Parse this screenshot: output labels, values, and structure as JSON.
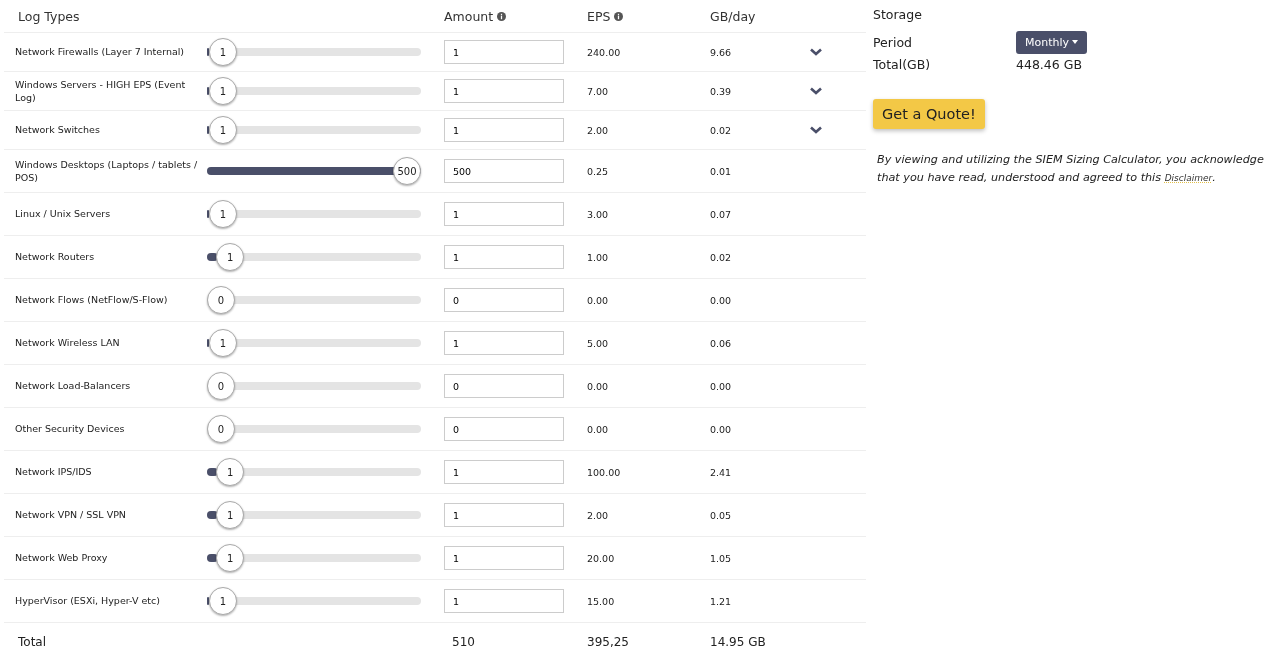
{
  "table": {
    "columns": [
      "Log Types",
      "Amount",
      "EPS",
      "GB/day"
    ],
    "rows": [
      {
        "name": "Network Firewalls (Layer 7 Internal)",
        "slider_value": "1",
        "level": 0.01,
        "amount": "1",
        "eps": "240.00",
        "gb_day": "9.66",
        "expandable": true
      },
      {
        "name": "Windows Servers - HIGH EPS (Event Log)",
        "slider_value": "1",
        "level": 0.01,
        "amount": "1",
        "eps": "7.00",
        "gb_day": "0.39",
        "expandable": true
      },
      {
        "name": "Network Switches",
        "slider_value": "1",
        "level": 0.01,
        "amount": "1",
        "eps": "2.00",
        "gb_day": "0.02",
        "expandable": true
      },
      {
        "name": "Windows Desktops (Laptops / tablets / POS)",
        "slider_value": "500",
        "level": 1,
        "amount": "500",
        "eps": "0.25",
        "gb_day": "0.01",
        "expandable": false
      },
      {
        "name": "Linux / Unix Servers",
        "slider_value": "1",
        "level": 0.01,
        "amount": "1",
        "eps": "3.00",
        "gb_day": "0.07",
        "expandable": false
      },
      {
        "name": "Network Routers",
        "slider_value": "1",
        "level": 0.05,
        "amount": "1",
        "eps": "1.00",
        "gb_day": "0.02",
        "expandable": false
      },
      {
        "name": "Network Flows (NetFlow/S-Flow)",
        "slider_value": "0",
        "level": 0,
        "amount": "0",
        "eps": "0.00",
        "gb_day": "0.00",
        "expandable": false
      },
      {
        "name": "Network Wireless LAN",
        "slider_value": "1",
        "level": 0.01,
        "amount": "1",
        "eps": "5.00",
        "gb_day": "0.06",
        "expandable": false
      },
      {
        "name": "Network Load-Balancers",
        "slider_value": "0",
        "level": 0,
        "amount": "0",
        "eps": "0.00",
        "gb_day": "0.00",
        "expandable": false
      },
      {
        "name": "Other Security Devices",
        "slider_value": "0",
        "level": 0,
        "amount": "0",
        "eps": "0.00",
        "gb_day": "0.00",
        "expandable": false
      },
      {
        "name": "Network IPS/IDS",
        "slider_value": "1",
        "level": 0.05,
        "amount": "1",
        "eps": "100.00",
        "gb_day": "2.41",
        "expandable": false
      },
      {
        "name": "Network VPN / SSL VPN",
        "slider_value": "1",
        "level": 0.05,
        "amount": "1",
        "eps": "2.00",
        "gb_day": "0.05",
        "expandable": false
      },
      {
        "name": "Network Web Proxy",
        "slider_value": "1",
        "level": 0.05,
        "amount": "1",
        "eps": "20.00",
        "gb_day": "1.05",
        "expandable": false
      },
      {
        "name": "HyperVisor (ESXi, Hyper-V etc)",
        "slider_value": "1",
        "level": 0.01,
        "amount": "1",
        "eps": "15.00",
        "gb_day": "1.21",
        "expandable": false
      }
    ],
    "total": {
      "label": "Total",
      "amount": "510",
      "eps": "395,25",
      "gb_day": "14.95 GB"
    }
  },
  "storage": {
    "title": "Storage",
    "period_label": "Period",
    "period_value": "Monthly",
    "total_label": "Total(GB)",
    "total_value": "448.46 GB"
  },
  "quote_button": "Get a Quote!",
  "disclaimer": {
    "text": "By viewing and utilizing the SIEM Sizing Calculator, you acknowledge that you have read, understood and agreed to this",
    "link": "Disclaimer",
    "end": "."
  }
}
